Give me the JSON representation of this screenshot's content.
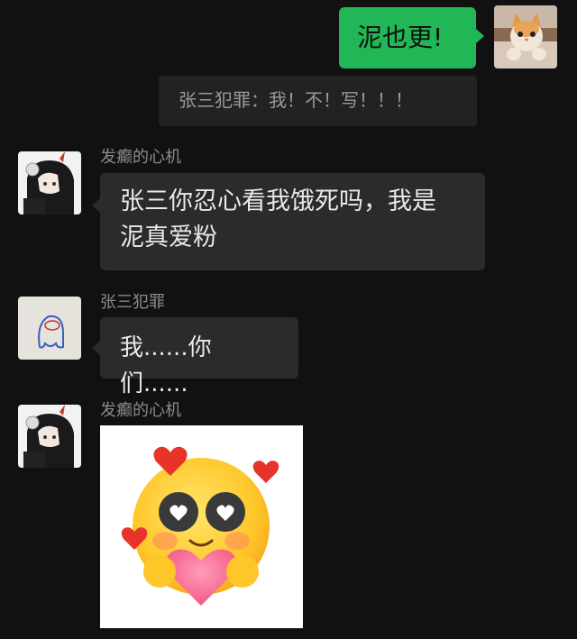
{
  "messages": {
    "m1": {
      "text": "泥也更!"
    },
    "quote": {
      "text": "张三犯罪：我！不！写！！！"
    },
    "m2": {
      "sender": "发癫的心机",
      "text_line1": "张三你忍心看我饿死吗，我是",
      "text_line2": "泥真爱粉"
    },
    "m3": {
      "sender": "张三犯罪",
      "text": "我......你们......"
    },
    "m4": {
      "sender": "发癫的心机",
      "sticker": "heart-eyes-emoji-sticker"
    }
  },
  "colors": {
    "background": "#111111",
    "bubble_other": "#2b2b2b",
    "bubble_mine": "#21b656",
    "sender_name": "#8a8a8a"
  }
}
